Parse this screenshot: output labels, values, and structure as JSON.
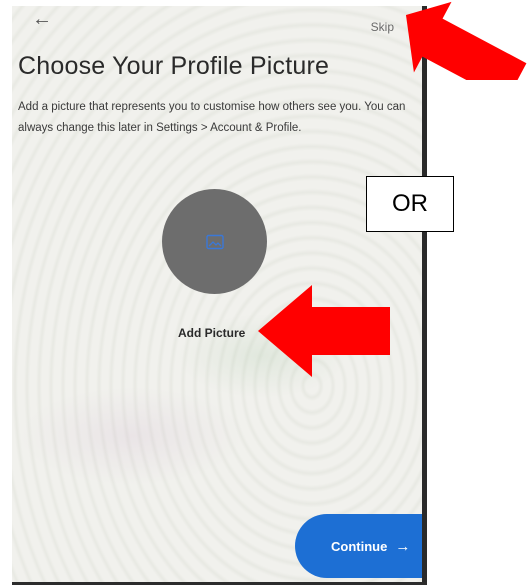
{
  "header": {
    "back_icon": "←",
    "skip_label": "Skip"
  },
  "main": {
    "title": "Choose Your Profile Picture",
    "description": "Add a picture that represents you to customise how others see you. You can always change this later in Settings > Account & Profile.",
    "add_picture_label": "Add Picture",
    "avatar_icon": "image-icon"
  },
  "footer": {
    "continue_label": "Continue",
    "continue_arrow": "→"
  },
  "annotation": {
    "or_label": "OR",
    "arrow_color": "#ff0000"
  },
  "colors": {
    "accent": "#1d6fd4",
    "avatar_bg": "#6d6d6d"
  }
}
